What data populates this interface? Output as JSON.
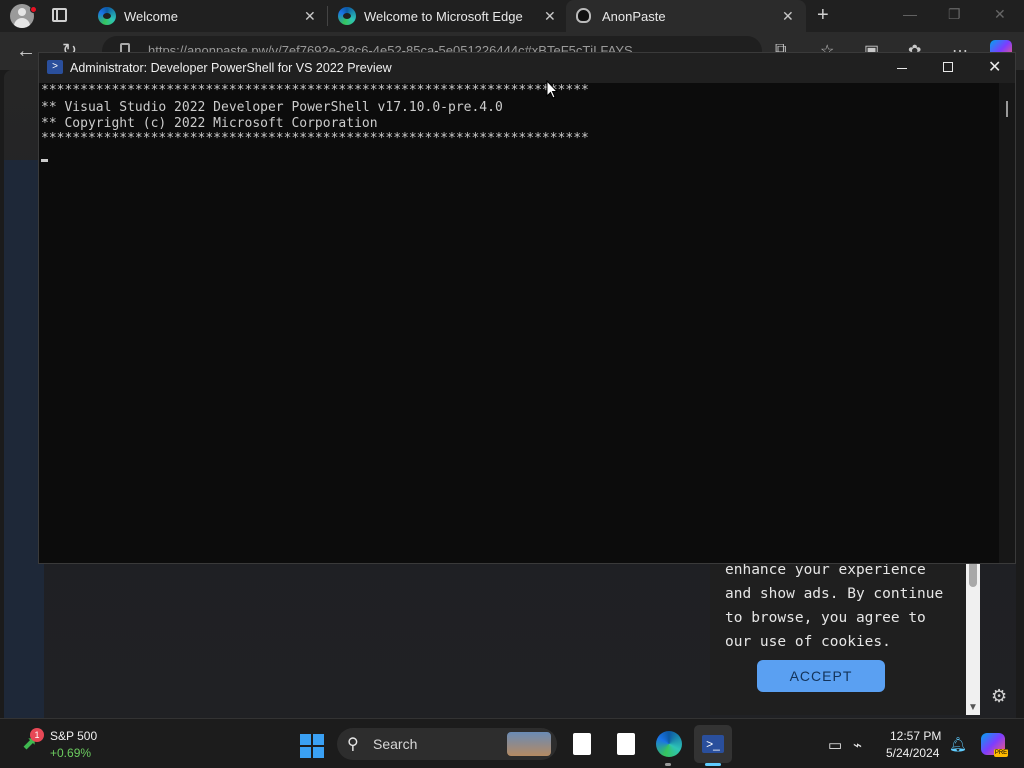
{
  "browser": {
    "tabs": [
      {
        "title": "Welcome",
        "close": "✕"
      },
      {
        "title": "Welcome to Microsoft Edge",
        "close": "✕"
      },
      {
        "title": "AnonPaste",
        "close": "✕"
      }
    ],
    "new_tab": "+",
    "url": "https://anonpaste.pw/v/7ef7692e-28c6-4e52-85ca-5e051226444c#xBTeF5cTjLFAYS..."
  },
  "console": {
    "title": "Administrator: Developer PowerShell for VS 2022 Preview",
    "lines": [
      "**********************************************************************",
      "** Visual Studio 2022 Developer PowerShell v17.10.0-pre.4.0",
      "** Copyright (c) 2022 Microsoft Corporation",
      "**********************************************************************"
    ]
  },
  "page": {
    "cookie_lines": [
      "enhance your experience",
      "and show ads. By continue",
      "to browse, you agree to",
      "our use of cookies."
    ],
    "accept_label": "ACCEPT"
  },
  "taskbar": {
    "stock_name": "S&P 500",
    "stock_change": "+0.69%",
    "stock_badge": "1",
    "search_label": "Search",
    "time": "12:57 PM",
    "date": "5/24/2024",
    "copilot_badge": "PRE"
  },
  "colors": {
    "accent": "#60cdff",
    "accept_button": "#5aa0f2",
    "stock_up": "#6ccb5f"
  }
}
